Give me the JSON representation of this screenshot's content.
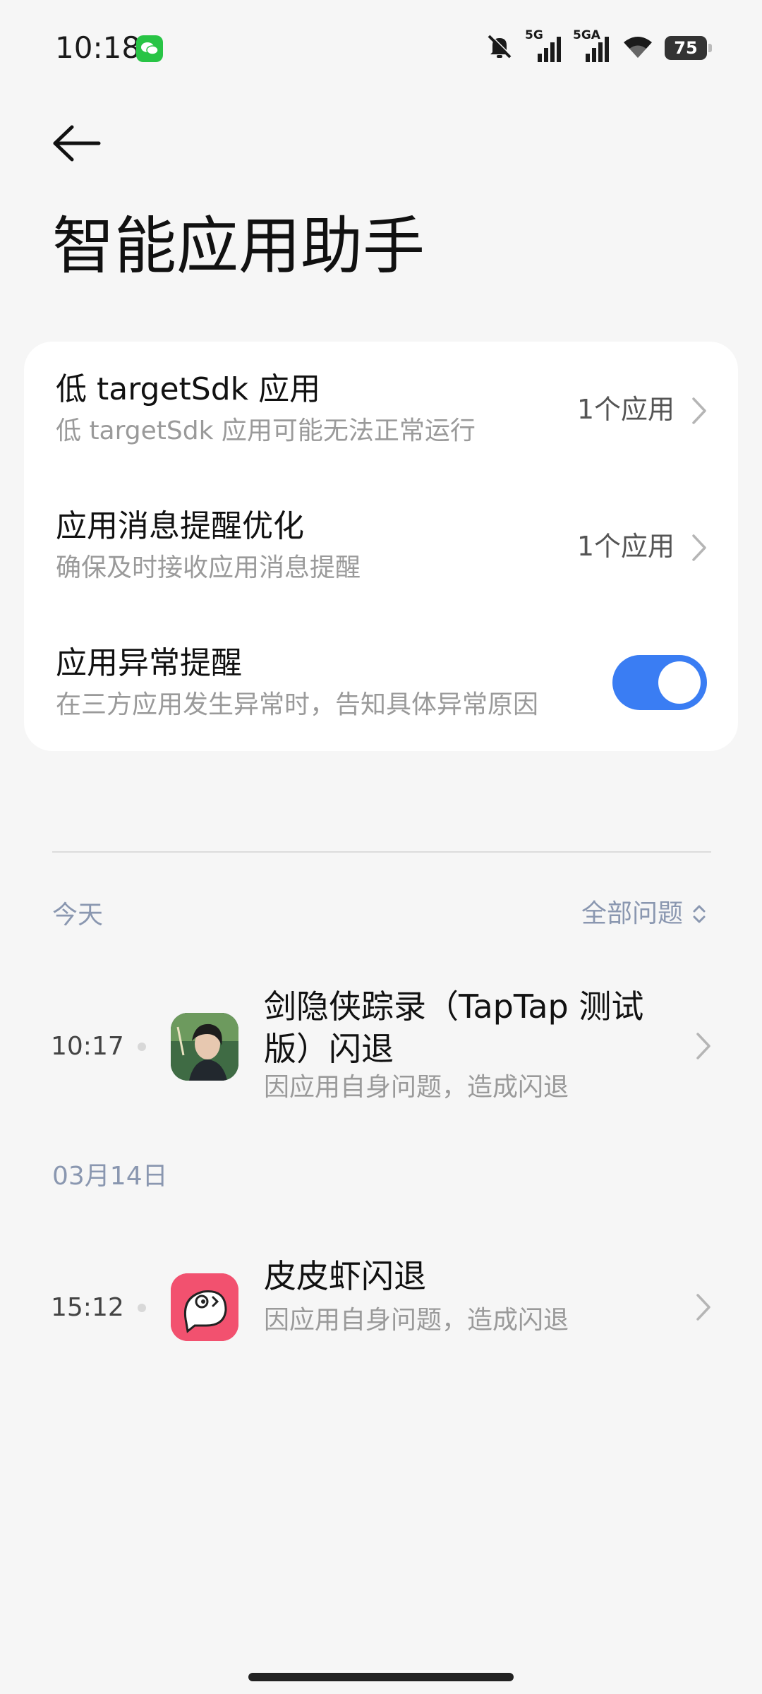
{
  "status_bar": {
    "time": "10:18",
    "signal1_label": "5G",
    "signal2_label": "5GA",
    "battery": "75"
  },
  "header": {
    "title": "智能应用助手"
  },
  "settings": {
    "low_sdk": {
      "title": "低 targetSdk 应用",
      "subtitle": "低 targetSdk 应用可能无法正常运行",
      "value": "1个应用"
    },
    "msg_opt": {
      "title": "应用消息提醒优化",
      "subtitle": "确保及时接收应用消息提醒",
      "value": "1个应用"
    },
    "abnormal": {
      "title": "应用异常提醒",
      "subtitle": "在三方应用发生异常时，告知具体异常原因",
      "enabled": true
    }
  },
  "timeline": {
    "filter_label": "全部问题",
    "groups": [
      {
        "date": "今天",
        "events": [
          {
            "time": "10:17",
            "title": "剑隐侠踪录（TapTap 测试版）闪退",
            "subtitle": "因应用自身问题，造成闪退",
            "icon": "game-icon"
          }
        ]
      },
      {
        "date": "03月14日",
        "events": [
          {
            "time": "15:12",
            "title": "皮皮虾闪退",
            "subtitle": "因应用自身问题，造成闪退",
            "icon": "pipixia-icon"
          }
        ]
      }
    ]
  },
  "colors": {
    "accent": "#3a7df3",
    "background": "#f6f6f6",
    "muted_label": "#8a97b0",
    "pipixia": "#f2516f"
  }
}
